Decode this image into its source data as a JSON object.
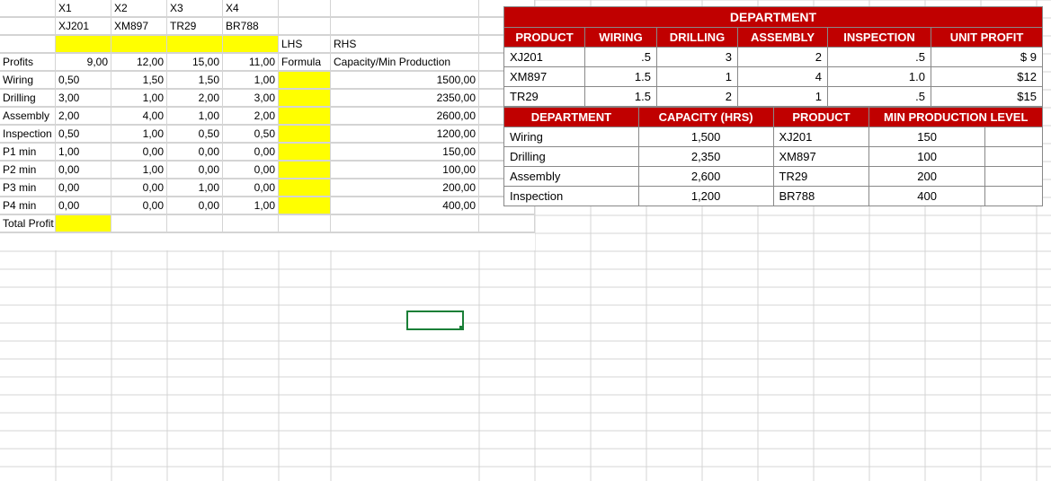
{
  "sheet": {
    "row1": {
      "x1": "X1",
      "x2": "X2",
      "x3": "X3",
      "x4": "X4"
    },
    "row2": {
      "x1": "XJ201",
      "x2": "XM897",
      "x3": "TR29",
      "x4": "BR788"
    },
    "row3": {
      "lhs": "LHS",
      "rhs": "RHS"
    },
    "row4": {
      "lab": "Profits",
      "x1": "9,00",
      "x2": "12,00",
      "x3": "15,00",
      "x4": "11,00",
      "lhs": "Formula",
      "rhs": "Capacity/Min Production"
    },
    "row5": {
      "lab": "Wiring",
      "x1": "0,50",
      "x2": "1,50",
      "x3": "1,50",
      "x4": "1,00",
      "rhs": "1500,00"
    },
    "row6": {
      "lab": "Drilling",
      "x1": "3,00",
      "x2": "1,00",
      "x3": "2,00",
      "x4": "3,00",
      "rhs": "2350,00"
    },
    "row7": {
      "lab": "Assembly",
      "x1": "2,00",
      "x2": "4,00",
      "x3": "1,00",
      "x4": "2,00",
      "rhs": "2600,00"
    },
    "row8": {
      "lab": "Inspection",
      "x1": "0,50",
      "x2": "1,00",
      "x3": "0,50",
      "x4": "0,50",
      "rhs": "1200,00"
    },
    "row9": {
      "lab": "P1 min",
      "x1": "1,00",
      "x2": "0,00",
      "x3": "0,00",
      "x4": "0,00",
      "rhs": "150,00"
    },
    "row10": {
      "lab": "P2 min",
      "x1": "0,00",
      "x2": "1,00",
      "x3": "0,00",
      "x4": "0,00",
      "rhs": "100,00"
    },
    "row11": {
      "lab": "P3 min",
      "x1": "0,00",
      "x2": "0,00",
      "x3": "1,00",
      "x4": "0,00",
      "rhs": "200,00"
    },
    "row12": {
      "lab": "P4 min",
      "x1": "0,00",
      "x2": "0,00",
      "x3": "0,00",
      "x4": "1,00",
      "rhs": "400,00"
    },
    "row13": {
      "lab": "Total Profit"
    }
  },
  "table1": {
    "title": "DEPARTMENT",
    "headers": [
      "PRODUCT",
      "WIRING",
      "DRILLING",
      "ASSEMBLY",
      "INSPECTION",
      "UNIT PROFIT"
    ],
    "rows": [
      {
        "p": "XJ201",
        "w": ".5",
        "d": "3",
        "a": "2",
        "i": ".5",
        "u": "$  9"
      },
      {
        "p": "XM897",
        "w": "1.5",
        "d": "1",
        "a": "4",
        "i": "1.0",
        "u": "$12"
      },
      {
        "p": "TR29",
        "w": "1.5",
        "d": "2",
        "a": "1",
        "i": ".5",
        "u": "$15"
      }
    ]
  },
  "table2": {
    "headers": [
      "DEPARTMENT",
      "CAPACITY (HRS)",
      "PRODUCT",
      "MIN PRODUCTION LEVEL"
    ],
    "rows": [
      {
        "d": "Wiring",
        "c": "1,500",
        "p": "XJ201",
        "m": "150"
      },
      {
        "d": "Drilling",
        "c": "2,350",
        "p": "XM897",
        "m": "100"
      },
      {
        "d": "Assembly",
        "c": "2,600",
        "p": "TR29",
        "m": "200"
      },
      {
        "d": "Inspection",
        "c": "1,200",
        "p": "BR788",
        "m": "400"
      }
    ]
  }
}
